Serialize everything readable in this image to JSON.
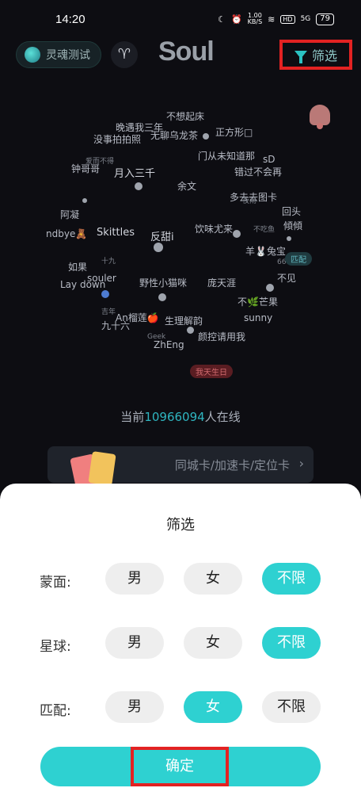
{
  "status": {
    "time": "14:20",
    "netspeed": "1.00\nKB/S",
    "hd": "HD",
    "signal": "5G",
    "battery": "79"
  },
  "header": {
    "soul_test_label": "灵魂测试",
    "zodiac_symbol": "♈",
    "logo": "Soul",
    "filter_label": "筛选"
  },
  "cloud_words": [
    "不想起床",
    "晚遇我三年",
    "无聊乌龙茶",
    "正方形□",
    "没事拍拍照",
    "钟哥哥",
    "月入三千",
    "爱而不得",
    "门从未知道那",
    "sD",
    "错过不会再",
    "余文",
    "多去去图卡",
    "夜雨",
    "阿凝",
    "回头",
    "ndbye🧸",
    "Skittles",
    "反甜i",
    "饮味尤来",
    "不吃鱼",
    "傾傾",
    "羊🐰兔宝",
    "666",
    "如果",
    "十九",
    "souler",
    "野性小猫咪",
    "庞天涯",
    "不见",
    "Lay down",
    "不🌿芒果",
    "sunny",
    "吉年",
    "九十六",
    "An榴莲🍎",
    "生理解韵",
    "颜控请用我",
    "Geek",
    "ZhEng"
  ],
  "cloud_pills": [
    "匹配",
    "我天生日"
  ],
  "online": {
    "prefix": "当前",
    "count": "10966094",
    "suffix": "人在线"
  },
  "banner": {
    "text": "同城卡/加速卡/定位卡",
    "chevron": "›"
  },
  "sheet": {
    "title": "筛选",
    "rows": [
      {
        "label": "蒙面:",
        "options": [
          "男",
          "女",
          "不限"
        ],
        "selected": 2
      },
      {
        "label": "星球:",
        "options": [
          "男",
          "女",
          "不限"
        ],
        "selected": 2
      },
      {
        "label": "匹配:",
        "options": [
          "男",
          "女",
          "不限"
        ],
        "selected": 1
      }
    ],
    "confirm": "确定"
  },
  "colors": {
    "accent": "#2ed1d1",
    "highlight": "#e32222",
    "background": "#0d0d12"
  }
}
